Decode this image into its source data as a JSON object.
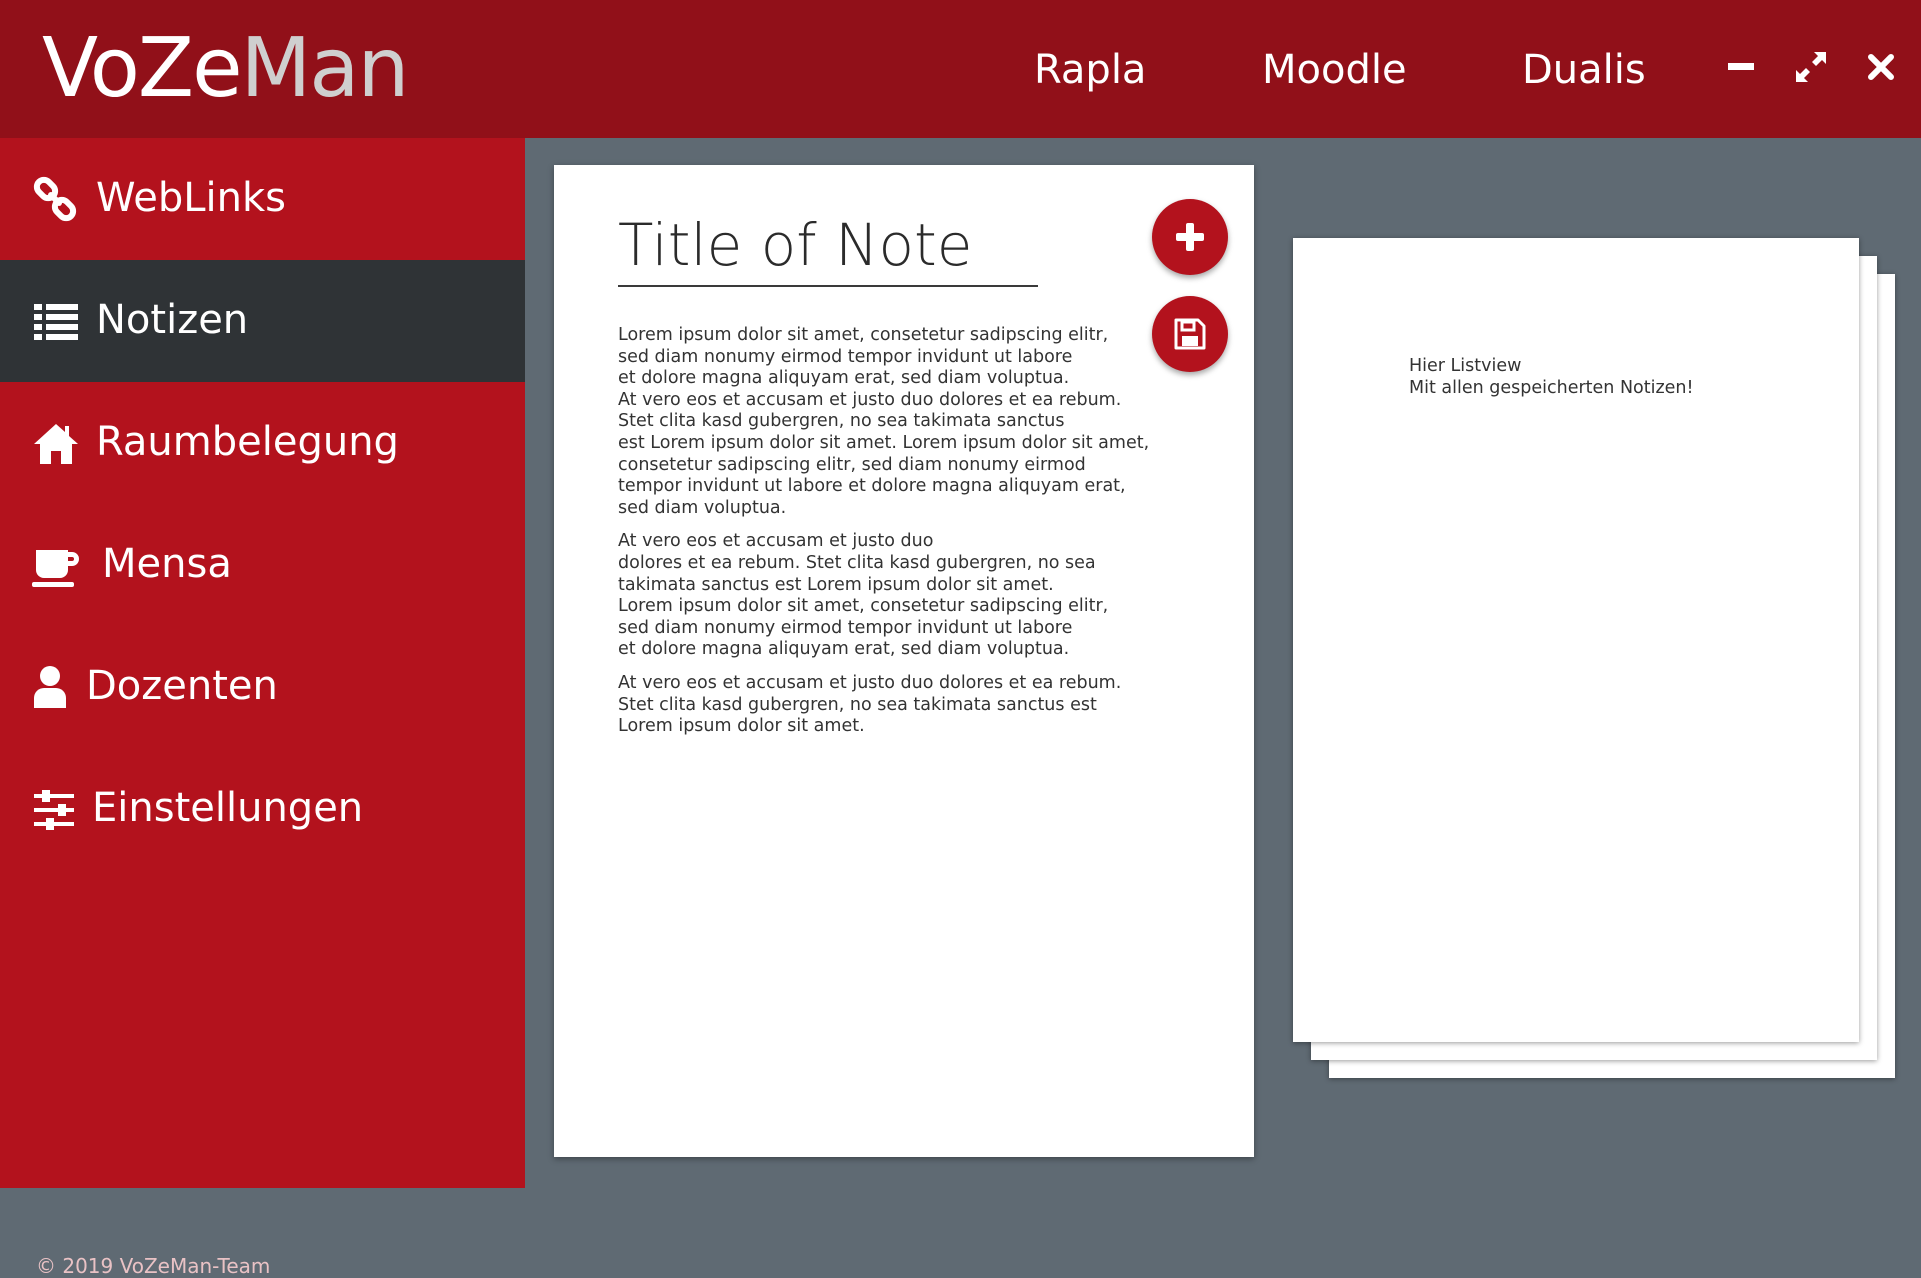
{
  "app": {
    "logo_prefix": "VoZe",
    "logo_suffix": "Man"
  },
  "header": {
    "nav": [
      {
        "label": "Rapla"
      },
      {
        "label": "Moodle"
      },
      {
        "label": "Dualis"
      }
    ],
    "window_controls": [
      "minimize-icon",
      "maximize-icon",
      "close-icon"
    ]
  },
  "sidebar": {
    "items": [
      {
        "label": "WebLinks",
        "icon": "link-icon"
      },
      {
        "label": "Notizen",
        "icon": "list-icon",
        "active": true
      },
      {
        "label": "Raumbelegung",
        "icon": "home-icon"
      },
      {
        "label": "Mensa",
        "icon": "coffee-cup-icon"
      },
      {
        "label": "Dozenten",
        "icon": "user-icon"
      },
      {
        "label": "Einstellungen",
        "icon": "sliders-icon"
      }
    ],
    "footer": "© 2019 VoZeMan-Team"
  },
  "editor": {
    "title": "Title of Note",
    "paragraphs": [
      [
        "Lorem ipsum dolor sit amet, consetetur sadipscing elitr,",
        "sed diam nonumy eirmod tempor invidunt ut labore",
        "et dolore magna aliquyam erat, sed diam voluptua.",
        "At vero eos et accusam et justo duo dolores et ea rebum.",
        "Stet clita kasd gubergren, no sea takimata sanctus",
        "est Lorem ipsum dolor sit amet. Lorem ipsum dolor sit amet,",
        "consetetur sadipscing elitr, sed diam nonumy eirmod",
        "tempor invidunt ut labore et dolore magna aliquyam erat,",
        "sed diam voluptua."
      ],
      [
        "At vero eos et accusam et justo duo",
        "dolores et ea rebum. Stet clita kasd gubergren, no sea",
        "takimata sanctus est Lorem ipsum dolor sit amet.",
        "Lorem ipsum dolor sit amet, consetetur sadipscing elitr,",
        "sed diam nonumy eirmod tempor invidunt ut labore",
        "et dolore magna aliquyam erat, sed diam voluptua."
      ],
      [
        "At vero eos et accusam et justo duo dolores et ea rebum.",
        "Stet clita kasd gubergren, no sea takimata sanctus est",
        "Lorem ipsum dolor sit amet."
      ]
    ],
    "actions": [
      "add-icon",
      "save-icon"
    ]
  },
  "notes_list": {
    "line1": "Hier Listview",
    "line2": "Mit allen gespeicherten Notizen!"
  },
  "colors": {
    "header_bg": "#911019",
    "sidebar_bg": "#b3121d",
    "active_item_bg": "#2f3336",
    "content_bg": "#5f6a73",
    "logo_suffix": "#cfcfcf"
  }
}
